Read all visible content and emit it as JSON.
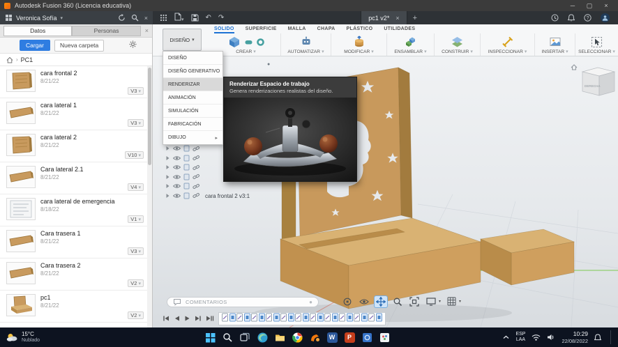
{
  "title_bar": {
    "app_title": "Autodesk Fusion 360 (Licencia educativa)"
  },
  "app_bar": {
    "user_name": "Veronica Sofía",
    "doc_tab_label": "pc1 v2*"
  },
  "data_panel": {
    "tab_datos": "Datos",
    "tab_personas": "Personas",
    "upload_button": "Cargar",
    "new_folder_button": "Nueva carpeta",
    "breadcrumb_root": "PC1",
    "items": [
      {
        "name": "cara frontal 2",
        "date": "8/21/22",
        "version": "V3",
        "thumb": "wood-panel"
      },
      {
        "name": "cara lateral 1",
        "date": "8/21/22",
        "version": "V3",
        "thumb": "wood-board"
      },
      {
        "name": "cara lateral 2",
        "date": "8/21/22",
        "version": "V10",
        "thumb": "wood-panel"
      },
      {
        "name": "Cara lateral 2.1",
        "date": "8/21/22",
        "version": "V4",
        "thumb": "wood-board"
      },
      {
        "name": "cara lateral de emergencia",
        "date": "8/18/22",
        "version": "V1",
        "thumb": "drawing"
      },
      {
        "name": "Cara trasera 1",
        "date": "8/21/22",
        "version": "V3",
        "thumb": "wood-board"
      },
      {
        "name": "Cara trasera 2",
        "date": "8/21/22",
        "version": "V2",
        "thumb": "wood-board"
      },
      {
        "name": "pc1",
        "date": "8/21/22",
        "version": "V2",
        "thumb": "assembly"
      }
    ]
  },
  "workspace_menu": {
    "selector_label": "DISEÑO",
    "items": [
      {
        "label": "DISEÑO",
        "highlighted": false,
        "submenu": false
      },
      {
        "label": "DISEÑO GENERATIVO",
        "highlighted": false,
        "submenu": false
      },
      {
        "label": "RENDERIZAR",
        "highlighted": true,
        "submenu": false
      },
      {
        "label": "ANIMACIÓN",
        "highlighted": false,
        "submenu": false
      },
      {
        "label": "SIMULACIÓN",
        "highlighted": false,
        "submenu": false
      },
      {
        "label": "FABRICACIÓN",
        "highlighted": false,
        "submenu": false
      },
      {
        "label": "DIBUJO",
        "highlighted": false,
        "submenu": true
      }
    ]
  },
  "ribbon": {
    "tabs": [
      {
        "label": "SOLIDO",
        "active": true
      },
      {
        "label": "SUPERFICIE",
        "active": false
      },
      {
        "label": "MALLA",
        "active": false
      },
      {
        "label": "CHAPA",
        "active": false
      },
      {
        "label": "PLÁSTICO",
        "active": false
      },
      {
        "label": "UTILIDADES",
        "active": false
      }
    ],
    "groups": [
      {
        "label": "CREAR"
      },
      {
        "label": "AUTOMATIZAR"
      },
      {
        "label": "MODIFICAR"
      },
      {
        "label": "ENSAMBLAR"
      },
      {
        "label": "CONSTRUIR"
      },
      {
        "label": "INSPECCIONAR"
      },
      {
        "label": "INSERTAR"
      },
      {
        "label": "SELECCIONAR"
      }
    ]
  },
  "render_tooltip": {
    "title": "Renderizar Espacio de trabajo",
    "description": "Genera renderizaciones realistas del diseño."
  },
  "browser_tree": {
    "visible_item_label": "cara frontal 2 v3:1"
  },
  "viewport": {
    "comments_label": "COMENTARIOS",
    "viewcube_face_label": "DERECHA"
  },
  "timeline": {
    "markers": [
      "sketch",
      "feature",
      "sketch",
      "feature",
      "sketch",
      "feature",
      "sketch",
      "feature",
      "sketch",
      "feature",
      "sketch",
      "feature",
      "sketch",
      "feature",
      "sketch",
      "feature",
      "sketch",
      "feature",
      "sketch",
      "feature",
      "sketch",
      "feature"
    ]
  },
  "taskbar": {
    "weather_temp": "15°C",
    "weather_desc": "Nublado",
    "keyboard_lang": "ESP",
    "keyboard_region": "LAA",
    "time": "10:29",
    "date": "22/08/2022",
    "apps": [
      {
        "name": "start"
      },
      {
        "name": "search"
      },
      {
        "name": "task-view"
      },
      {
        "name": "edge"
      },
      {
        "name": "file-explorer"
      },
      {
        "name": "chrome"
      },
      {
        "name": "fusion-360"
      },
      {
        "name": "word"
      },
      {
        "name": "powerpoint"
      },
      {
        "name": "photos"
      },
      {
        "name": "paint"
      }
    ]
  }
}
